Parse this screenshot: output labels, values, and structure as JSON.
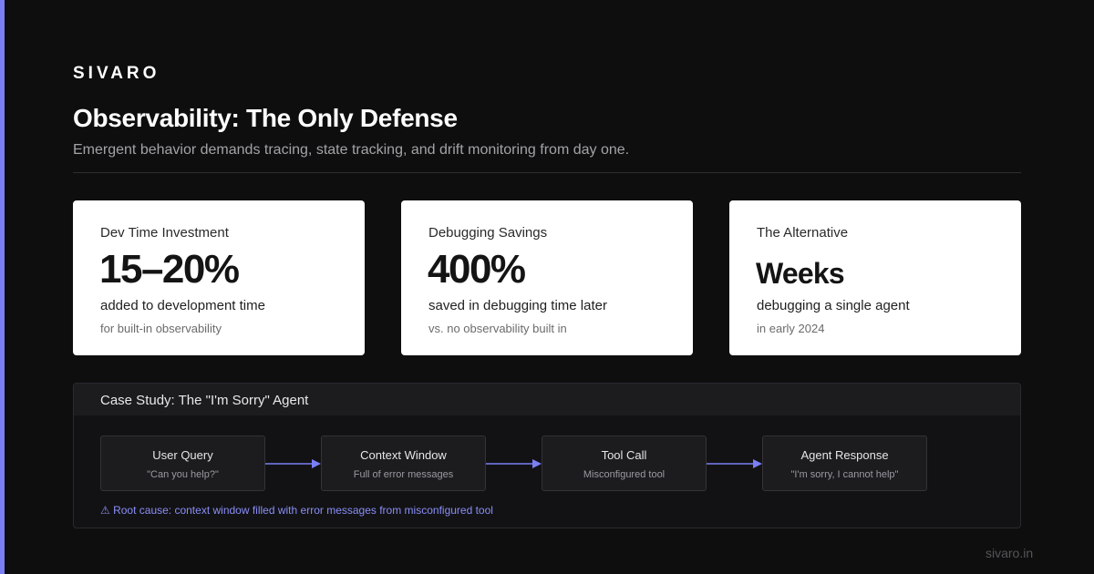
{
  "brand": "SIVARO",
  "header": {
    "title": "Observability: The Only Defense",
    "subtitle": "Emergent behavior demands tracing, state tracking, and drift monitoring from day one."
  },
  "cards": [
    {
      "label": "Dev Time Investment",
      "value": "15–20%",
      "description": "added to development time",
      "note": "for built-in observability"
    },
    {
      "label": "Debugging Savings",
      "value": "400%",
      "description": "saved in debugging time later",
      "note": "vs. no observability built in"
    },
    {
      "label": "The Alternative",
      "value": "Weeks",
      "description": "debugging a single agent",
      "note": "in early 2024"
    }
  ],
  "case_study": {
    "title": "Case Study: The \"I'm Sorry\" Agent",
    "steps": [
      {
        "name": "User Query",
        "detail": "\"Can you help?\""
      },
      {
        "name": "Context Window",
        "detail": "Full of error messages"
      },
      {
        "name": "Tool Call",
        "detail": "Misconfigured tool"
      },
      {
        "name": "Agent Response",
        "detail": "\"I'm sorry, I cannot help\""
      }
    ],
    "root_cause": "⚠ Root cause: context window filled with error messages from misconfigured tool"
  },
  "footer": {
    "site": "sivaro.in"
  },
  "colors": {
    "accent": "#7b7ff5",
    "background": "#0e0e0e",
    "card": "#ffffff"
  }
}
